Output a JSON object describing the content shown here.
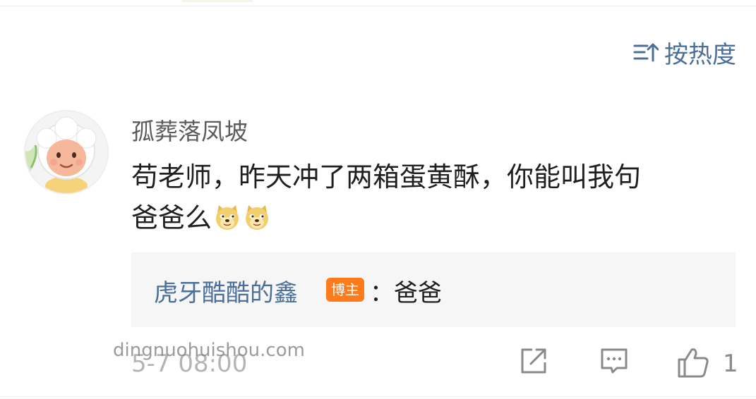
{
  "sort": {
    "label": "按热度",
    "icon": "sort-icon"
  },
  "comment": {
    "avatar_icon": "cartoon-sheep-avatar",
    "username": "孤葬落凤坡",
    "text_line1": "苟老师，昨天冲了两箱蛋黄酥，你能叫我句",
    "text_line2": "爸爸么",
    "emojis": [
      "doge-emoji",
      "doge-emoji"
    ],
    "timestamp": "5-7 08:00",
    "like_count": "1"
  },
  "reply": {
    "author": "虎牙酷酷的鑫",
    "badge": "博主",
    "text": "：爸爸"
  },
  "actions": {
    "share_icon": "share-icon",
    "comment_icon": "comment-icon",
    "like_icon": "thumbs-up-icon"
  },
  "watermark": "dingnuohuishou.com",
  "colors": {
    "link_blue": "#4a6f98",
    "badge_orange": "#ff7a1a",
    "muted_gray": "#b4b4b4"
  }
}
